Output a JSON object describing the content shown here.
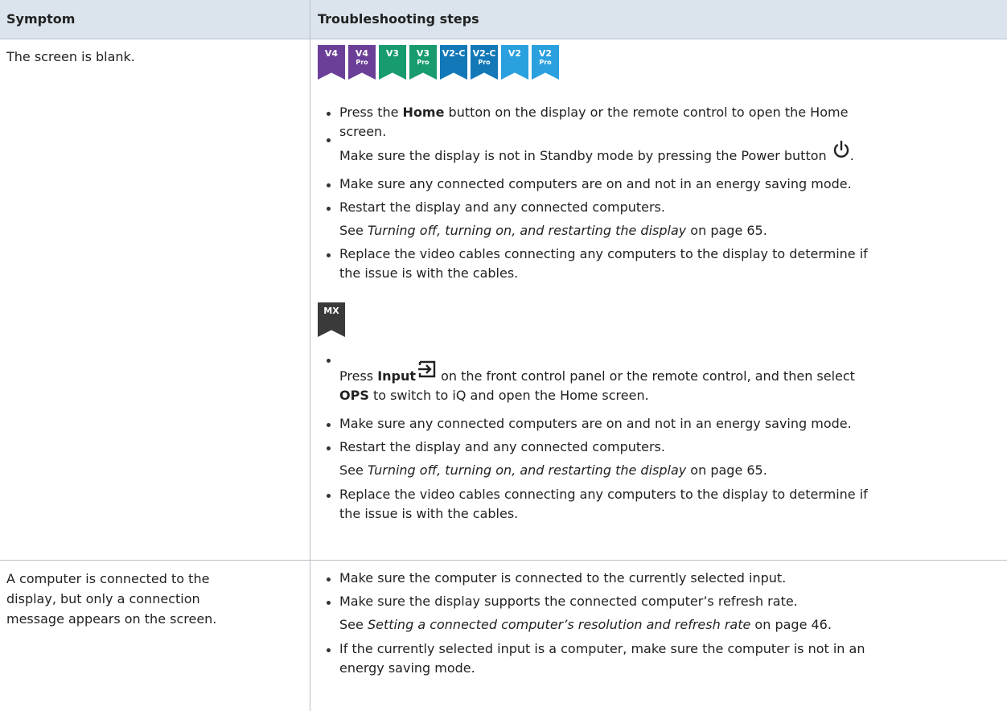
{
  "header": {
    "col1": "Symptom",
    "col2": "Troubleshooting steps"
  },
  "rows": [
    {
      "symptom": "The screen is blank.",
      "badges": [
        {
          "line1": "V4",
          "line2": "",
          "color": "#6b3f97"
        },
        {
          "line1": "V4",
          "line2": "Pro",
          "color": "#6b3f97"
        },
        {
          "line1": "V3",
          "line2": "",
          "color": "#179b6f"
        },
        {
          "line1": "V3",
          "line2": "Pro",
          "color": "#179b6f"
        },
        {
          "line1": "V2-C",
          "line2": "",
          "color": "#1278b7"
        },
        {
          "line1": "V2-C",
          "line2": "Pro",
          "color": "#1278b7"
        },
        {
          "line1": "V2",
          "line2": "",
          "color": "#2aa0df"
        },
        {
          "line1": "V2",
          "line2": "Pro",
          "color": "#2aa0df"
        }
      ],
      "steps_a": {
        "s1_pre": "Press the ",
        "s1_bold": "Home",
        "s1_post": " button on the display or the remote control to open the Home",
        "s1_cont": "screen.",
        "s2": "Make sure the display is not in Standby mode by pressing the Power button",
        "s2_end": ".",
        "s3": "Make sure any connected computers are on and not in an energy saving mode.",
        "s4": "Restart the display and any connected computers.",
        "s4_see": "See ",
        "s4_link": "Turning off, turning on, and restarting the display",
        "s4_page": " on page 65.",
        "s5": "Replace the video cables connecting any computers to the display to determine if",
        "s5_cont": "the issue is with the cables."
      },
      "mx_badge": {
        "label": "MX",
        "color": "#3a3a3a"
      },
      "steps_b": {
        "s1_pre": "Press ",
        "s1_bold": "Input",
        "s1_post": " on the front control panel or the remote control, and then select",
        "s1_bold2": "OPS",
        "s1_cont": " to switch to iQ and open the Home screen.",
        "s2": "Make sure any connected computers are on and not in an energy saving mode.",
        "s3": "Restart the display and any connected computers.",
        "s3_see": "See ",
        "s3_link": "Turning off, turning on, and restarting the display",
        "s3_page": " on page 65.",
        "s4": "Replace the video cables connecting any computers to the display to determine if",
        "s4_cont": "the issue is with the cables."
      }
    },
    {
      "symptom_l1": "A computer is connected to the",
      "symptom_l2": "display, but only a connection",
      "symptom_l3": "message appears on the screen.",
      "steps": {
        "s1": "Make sure the computer is connected to the currently selected input.",
        "s2": "Make sure the display supports the connected computer’s refresh rate.",
        "s2_see": "See ",
        "s2_link": "Setting a connected computer’s resolution and refresh rate",
        "s2_page": " on page 46.",
        "s3": "If the currently selected input is a computer, make sure the computer is not in an",
        "s3_cont": "energy saving mode."
      }
    }
  ]
}
